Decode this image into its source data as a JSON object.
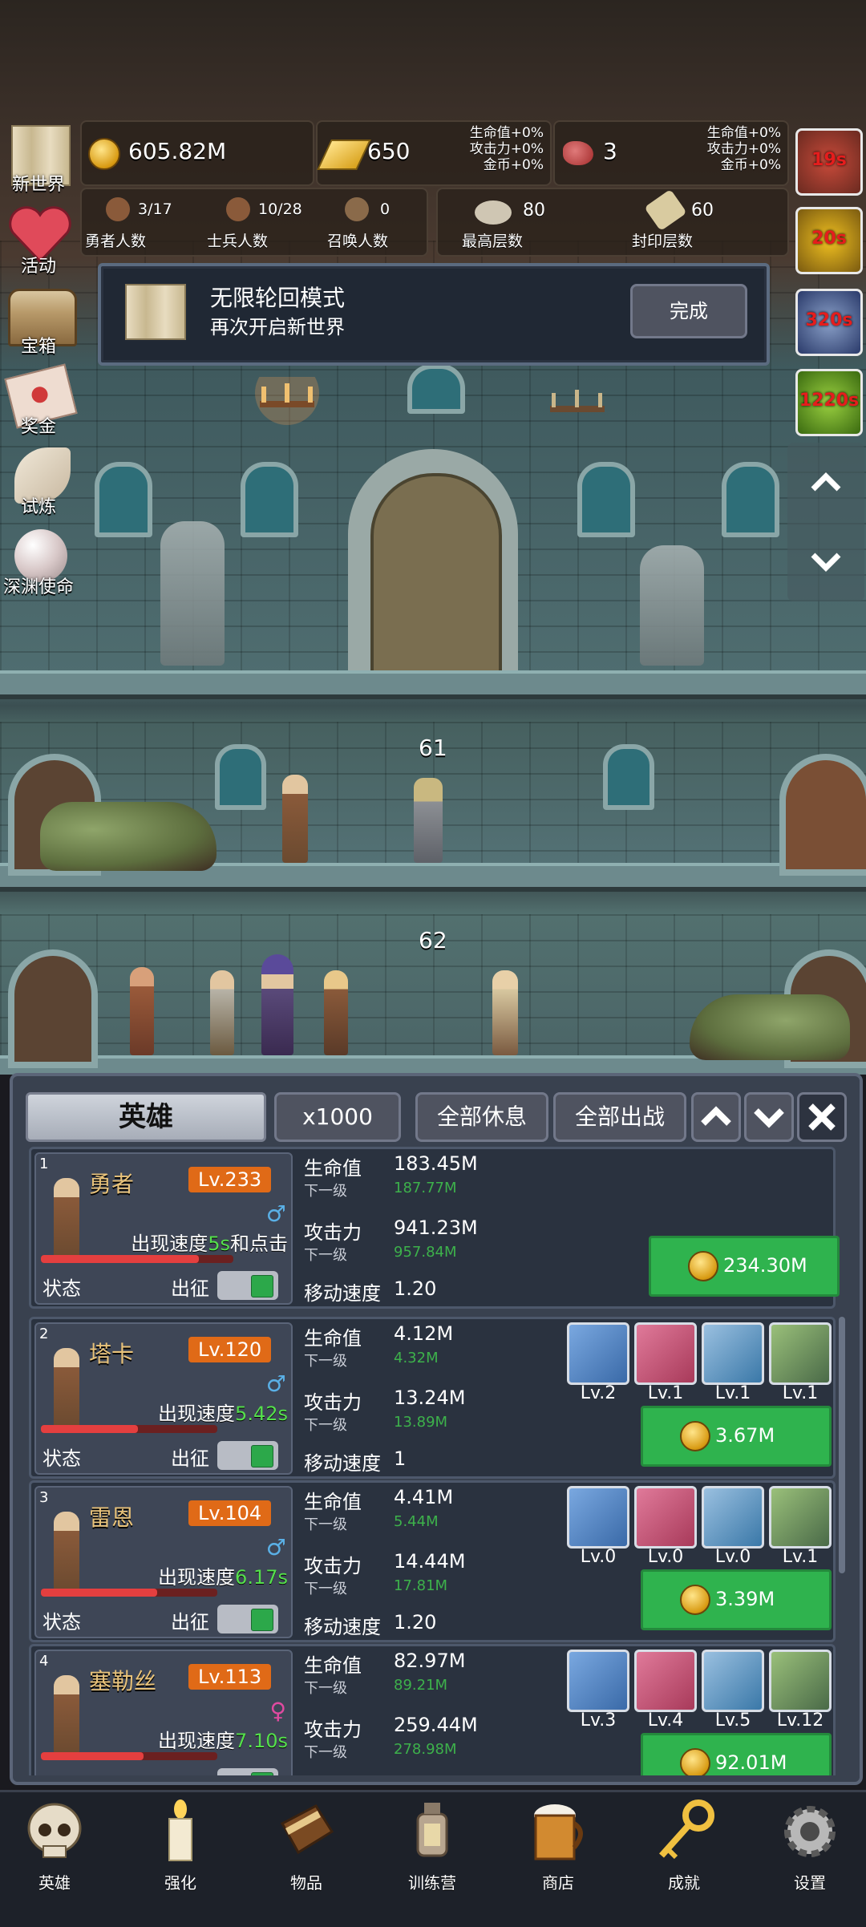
{
  "hud": {
    "gold": "605.82M",
    "bars": "650",
    "bars_bonus": [
      "生命值+0%",
      "攻击力+0%",
      "金币+0%"
    ],
    "meat": "3",
    "meat_bonus": [
      "生命值+0%",
      "攻击力+0%",
      "金币+0%"
    ],
    "heroes_count": "3/17",
    "heroes_label": "勇者人数",
    "soldiers_count": "10/28",
    "soldiers_label": "士兵人数",
    "summon_count": "0",
    "summon_label": "召唤人数",
    "max_floor": "80",
    "max_floor_label": "最高层数",
    "seal_floor": "60",
    "seal_floor_label": "封印层数"
  },
  "left_menu": [
    "新世界",
    "活动",
    "宝箱",
    "奖金",
    "试炼",
    "深渊使命"
  ],
  "timers": [
    "19s",
    "20s",
    "320s",
    "1220s"
  ],
  "quest": {
    "title": "无限轮回模式",
    "subtitle": "再次开启新世界",
    "button": "完成"
  },
  "floors": [
    "61",
    "62"
  ],
  "panel": {
    "tab": "英雄",
    "multiplier": "x1000",
    "rest_all": "全部休息",
    "deploy_all": "全部出战"
  },
  "labels": {
    "hp": "生命值",
    "next": "下一级",
    "atk": "攻击力",
    "move": "移动速度",
    "status": "状态",
    "deploy": "出征",
    "speed_prefix": "出现速度"
  },
  "heroes": [
    {
      "idx": "1",
      "name": "勇者",
      "level": "Lv.233",
      "gender": "male",
      "speed": "5s",
      "speed_suffix": "和点击",
      "hp": "183.45M",
      "hp_next": "187.77M",
      "atk": "941.23M",
      "atk_next": "957.84M",
      "move": "1.20",
      "cost": "234.30M",
      "hp_ratio": 0.82,
      "equips": []
    },
    {
      "idx": "2",
      "name": "塔卡",
      "level": "Lv.120",
      "gender": "male",
      "speed": "5.42s",
      "speed_suffix": "",
      "hp": "4.12M",
      "hp_next": "4.32M",
      "atk": "13.24M",
      "atk_next": "13.89M",
      "move": "1",
      "cost": "3.67M",
      "hp_ratio": 0.55,
      "equips": [
        "Lv.2",
        "Lv.1",
        "Lv.1",
        "Lv.1"
      ]
    },
    {
      "idx": "3",
      "name": "雷恩",
      "level": "Lv.104",
      "gender": "male",
      "speed": "6.17s",
      "speed_suffix": "",
      "hp": "4.41M",
      "hp_next": "5.44M",
      "atk": "14.44M",
      "atk_next": "17.81M",
      "move": "1.20",
      "cost": "3.39M",
      "hp_ratio": 0.66,
      "equips": [
        "Lv.0",
        "Lv.0",
        "Lv.0",
        "Lv.1"
      ]
    },
    {
      "idx": "4",
      "name": "塞勒丝",
      "level": "Lv.113",
      "gender": "female",
      "speed": "7.10s",
      "speed_suffix": "",
      "hp": "82.97M",
      "hp_next": "89.21M",
      "atk": "259.44M",
      "atk_next": "278.98M",
      "move": "",
      "cost": "92.01M",
      "hp_ratio": 0.58,
      "equips": [
        "Lv.3",
        "Lv.4",
        "Lv.5",
        "Lv.12"
      ]
    }
  ],
  "nav": [
    "英雄",
    "强化",
    "物品",
    "训练营",
    "商店",
    "成就",
    "设置"
  ]
}
